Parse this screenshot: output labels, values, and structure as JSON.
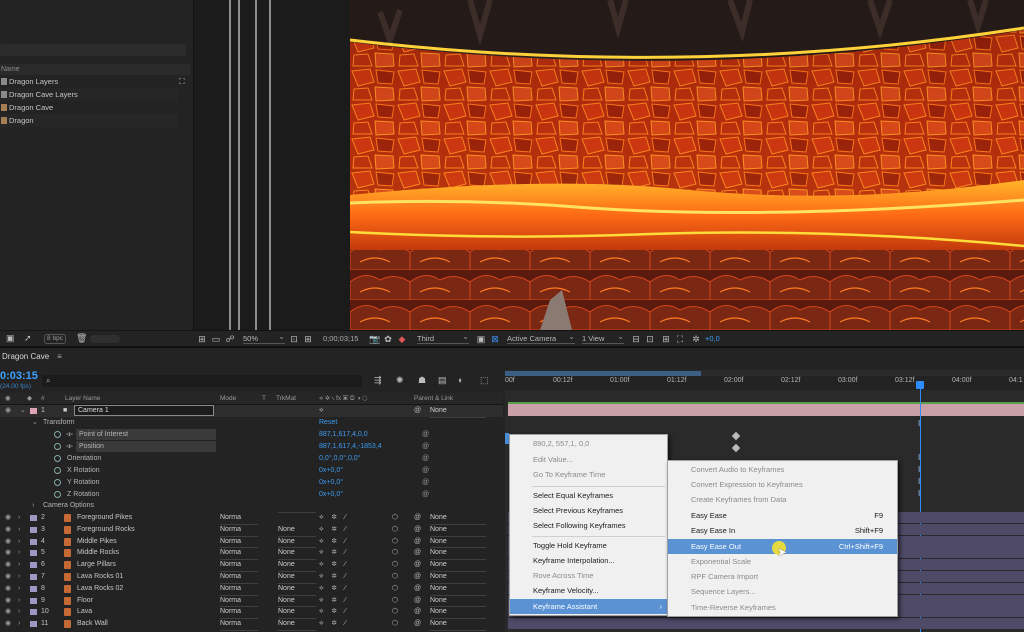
{
  "project": {
    "header_name": "Name",
    "items": [
      {
        "label": "Dragon Layers",
        "type": "folder"
      },
      {
        "label": "Dragon Cave Layers",
        "type": "folder"
      },
      {
        "label": "Dragon Cave",
        "type": "comp"
      },
      {
        "label": "Dragon",
        "type": "comp"
      }
    ],
    "bpc": "8 bpc"
  },
  "viewer_toolbar": {
    "zoom": "50%",
    "timecode": "0;00;03;15",
    "resolution": "Third",
    "camera": "Active Camera",
    "views": "1 View",
    "exposure": "+0,0"
  },
  "timeline": {
    "tab_title": "Dragon Cave",
    "current_time": "0:03:15",
    "fps": "(24.00 fps)",
    "search_placeholder": "",
    "columns": {
      "layer_name": "Layer Name",
      "mode": "Mode",
      "t": "T",
      "trkmat": "TrkMat",
      "parent": "Parent & Link",
      "num": "#"
    },
    "ruler_ticks": [
      "00f",
      "00:12f",
      "01:00f",
      "01:12f",
      "02:00f",
      "02:12f",
      "03:00f",
      "03:12f",
      "04:00f",
      "04:1"
    ],
    "camera_layer": {
      "num": "1",
      "name": "Camera 1",
      "parent": "None"
    },
    "transform": {
      "group_label": "Transform",
      "reset_label": "Reset",
      "properties": [
        {
          "name": "Point of Interest",
          "value": "887,1,617,4,0,0"
        },
        {
          "name": "Position",
          "value": "887,1,617,4,-1853,4"
        },
        {
          "name": "Orientation",
          "value": "0,0°,0,0°,0,0°"
        },
        {
          "name": "X Rotation",
          "value": "0x+0,0°"
        },
        {
          "name": "Y Rotation",
          "value": "0x+0,0°"
        },
        {
          "name": "Z Rotation",
          "value": "0x+0,0°"
        }
      ]
    },
    "camera_options_label": "Camera Options",
    "layers": [
      {
        "num": "2",
        "name": "Foreground Pikes",
        "mode": "Norma",
        "trkmat": "",
        "parent": "None"
      },
      {
        "num": "3",
        "name": "Foreground Rocks",
        "mode": "Norma",
        "trkmat": "None",
        "parent": "None"
      },
      {
        "num": "4",
        "name": "Middle Pikes",
        "mode": "Norma",
        "trkmat": "None",
        "parent": "None"
      },
      {
        "num": "5",
        "name": "Middle Rocks",
        "mode": "Norma",
        "trkmat": "None",
        "parent": "None"
      },
      {
        "num": "6",
        "name": "Large Pillars",
        "mode": "Norma",
        "trkmat": "None",
        "parent": "None"
      },
      {
        "num": "7",
        "name": "Lava Rocks 01",
        "mode": "Norma",
        "trkmat": "None",
        "parent": "None"
      },
      {
        "num": "8",
        "name": "Lava Rocks 02",
        "mode": "Norma",
        "trkmat": "None",
        "parent": "None"
      },
      {
        "num": "9",
        "name": "Floor",
        "mode": "Norma",
        "trkmat": "None",
        "parent": "None"
      },
      {
        "num": "10",
        "name": "Lava",
        "mode": "Norma",
        "trkmat": "None",
        "parent": "None"
      },
      {
        "num": "11",
        "name": "Back Wall",
        "mode": "Norma",
        "trkmat": "None",
        "parent": "None"
      }
    ]
  },
  "context_menu": {
    "items": [
      {
        "label": "890,2, 557,1, 0,0",
        "disabled": true
      },
      {
        "label": "Edit Value...",
        "disabled": true
      },
      {
        "label": "Go To Keyframe Time",
        "disabled": true
      },
      {
        "label": "Select Equal Keyframes",
        "disabled": false
      },
      {
        "label": "Select Previous Keyframes",
        "disabled": false
      },
      {
        "label": "Select Following Keyframes",
        "disabled": false
      },
      {
        "label": "Toggle Hold Keyframe",
        "disabled": false
      },
      {
        "label": "Keyframe Interpolation...",
        "disabled": false
      },
      {
        "label": "Rove Across Time",
        "disabled": true
      },
      {
        "label": "Keyframe Velocity...",
        "disabled": false
      },
      {
        "label": "Keyframe Assistant",
        "disabled": false
      }
    ]
  },
  "submenu": {
    "items": [
      {
        "label": "Convert Audio to Keyframes",
        "shortcut": "",
        "disabled": true
      },
      {
        "label": "Convert Expression to Keyframes",
        "shortcut": "",
        "disabled": true
      },
      {
        "label": "Create Keyframes from Data",
        "shortcut": "",
        "disabled": true
      },
      {
        "label": "Easy Ease",
        "shortcut": "F9",
        "disabled": false
      },
      {
        "label": "Easy Ease In",
        "shortcut": "Shift+F9",
        "disabled": false
      },
      {
        "label": "Easy Ease Out",
        "shortcut": "Ctrl+Shift+F9",
        "disabled": false
      },
      {
        "label": "Exponential Scale",
        "shortcut": "",
        "disabled": true
      },
      {
        "label": "RPF Camera Import",
        "shortcut": "",
        "disabled": true
      },
      {
        "label": "Sequence Layers...",
        "shortcut": "",
        "disabled": true
      },
      {
        "label": "Time-Reverse Keyframes",
        "shortcut": "",
        "disabled": true
      }
    ]
  },
  "colors": {
    "accent": "#2e8cff",
    "menu_highlight": "#5a92d4",
    "lava": "#ff5a1a"
  }
}
